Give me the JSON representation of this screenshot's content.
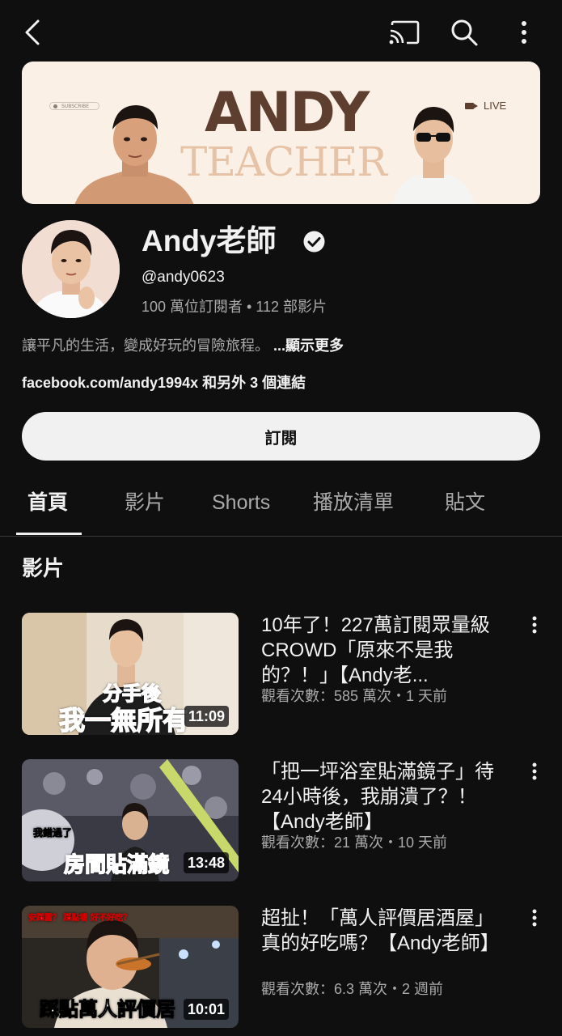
{
  "banner": {
    "subscribe_pill": "SUBSCRIBE",
    "title_line1": "ANDY",
    "title_line2": "TEACHER",
    "live": "LIVE"
  },
  "channel": {
    "name": "Andy老師",
    "handle": "@andy0623",
    "stats": "100 萬位訂閱者 • 112 部影片",
    "description": "讓平凡的生活，變成好玩的冒險旅程。 ",
    "show_more": "...顯示更多",
    "links": "facebook.com/andy1994x 和另外 3 個連結",
    "subscribe_label": "訂閱"
  },
  "tabs": [
    {
      "label": "首頁",
      "active": true
    },
    {
      "label": "影片",
      "active": false
    },
    {
      "label": "Shorts",
      "active": false
    },
    {
      "label": "播放清單",
      "active": false
    },
    {
      "label": "貼文",
      "active": false
    }
  ],
  "section_title": "影片",
  "videos": [
    {
      "title": "10年了！227萬訂閱眾量級CROWD「原來不是我的？！」【Andy老...",
      "meta": "觀看次數：585 萬次・1 天前",
      "duration": "11:09",
      "overlay_top": "分手後",
      "overlay_bottom": "我一無所有"
    },
    {
      "title": "「把一坪浴室貼滿鏡子」待24小時後，我崩潰了？！【Andy老師】",
      "meta": "觀看次數：21 萬次・10 天前",
      "duration": "13:48",
      "overlay_small": "我錯過了",
      "overlay_bottom": "房間貼滿鏡"
    },
    {
      "title": "超扯！「萬人評價居酒屋」真的好吃嗎？【Andy老師】",
      "meta": "觀看次數：6.3 萬次・2 週前",
      "duration": "10:01",
      "overlay_small": "安踩雷？ 踩點看 好不好吃？",
      "overlay_bottom": "踩點萬人評價居"
    }
  ],
  "colors": {
    "background": "#0f0f0f",
    "text_primary": "#f1f1f1",
    "text_secondary": "#aaaaaa",
    "banner_bg": "#fbf0e6",
    "banner_brown": "#5e3f2f",
    "thumb_overlay_red": "#e8302a"
  },
  "icons": [
    "back-icon",
    "cast-icon",
    "search-icon",
    "more-vert-icon",
    "verified-icon"
  ]
}
